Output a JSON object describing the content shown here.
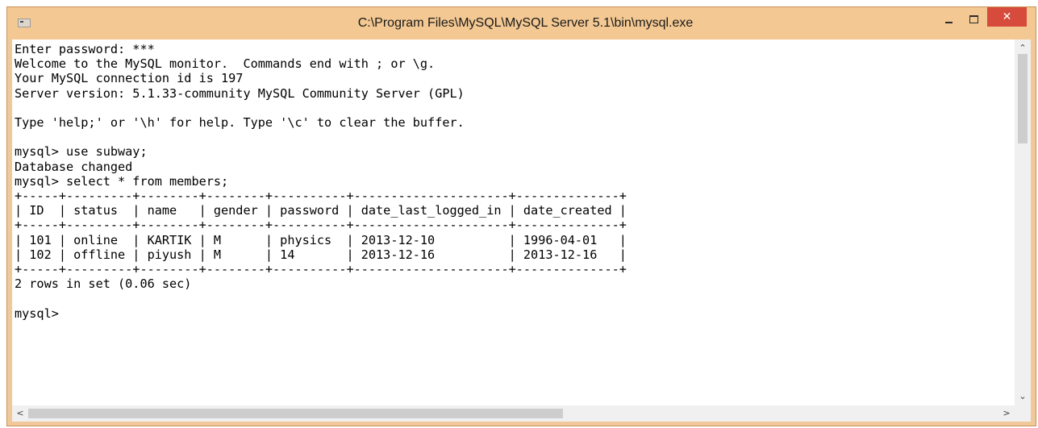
{
  "window": {
    "title": "C:\\Program Files\\MySQL\\MySQL Server 5.1\\bin\\mysql.exe",
    "close_glyph": "✕",
    "icons": [
      "console-app-icon",
      "minimize-icon",
      "maximize-icon",
      "close-icon"
    ]
  },
  "console": {
    "lines": [
      "Enter password: ***",
      "Welcome to the MySQL monitor.  Commands end with ; or \\g.",
      "Your MySQL connection id is 197",
      "Server version: 5.1.33-community MySQL Community Server (GPL)",
      "",
      "Type 'help;' or '\\h' for help. Type '\\c' to clear the buffer.",
      "",
      "mysql> use subway;",
      "Database changed",
      "mysql> select * from members;",
      "+-----+---------+--------+--------+----------+---------------------+--------------+",
      "| ID  | status  | name   | gender | password | date_last_logged_in | date_created |",
      "+-----+---------+--------+--------+----------+---------------------+--------------+",
      "| 101 | online  | KARTIK | M      | physics  | 2013-12-10          | 1996-04-01   |",
      "| 102 | offline | piyush | M      | 14       | 2013-12-16          | 2013-12-16   |",
      "+-----+---------+--------+--------+----------+---------------------+--------------+",
      "2 rows in set (0.06 sec)",
      "",
      "mysql>"
    ]
  },
  "scrollbars": {
    "up_arrow": "⌃",
    "down_arrow": "⌄",
    "left_arrow": "<",
    "right_arrow": ">"
  }
}
